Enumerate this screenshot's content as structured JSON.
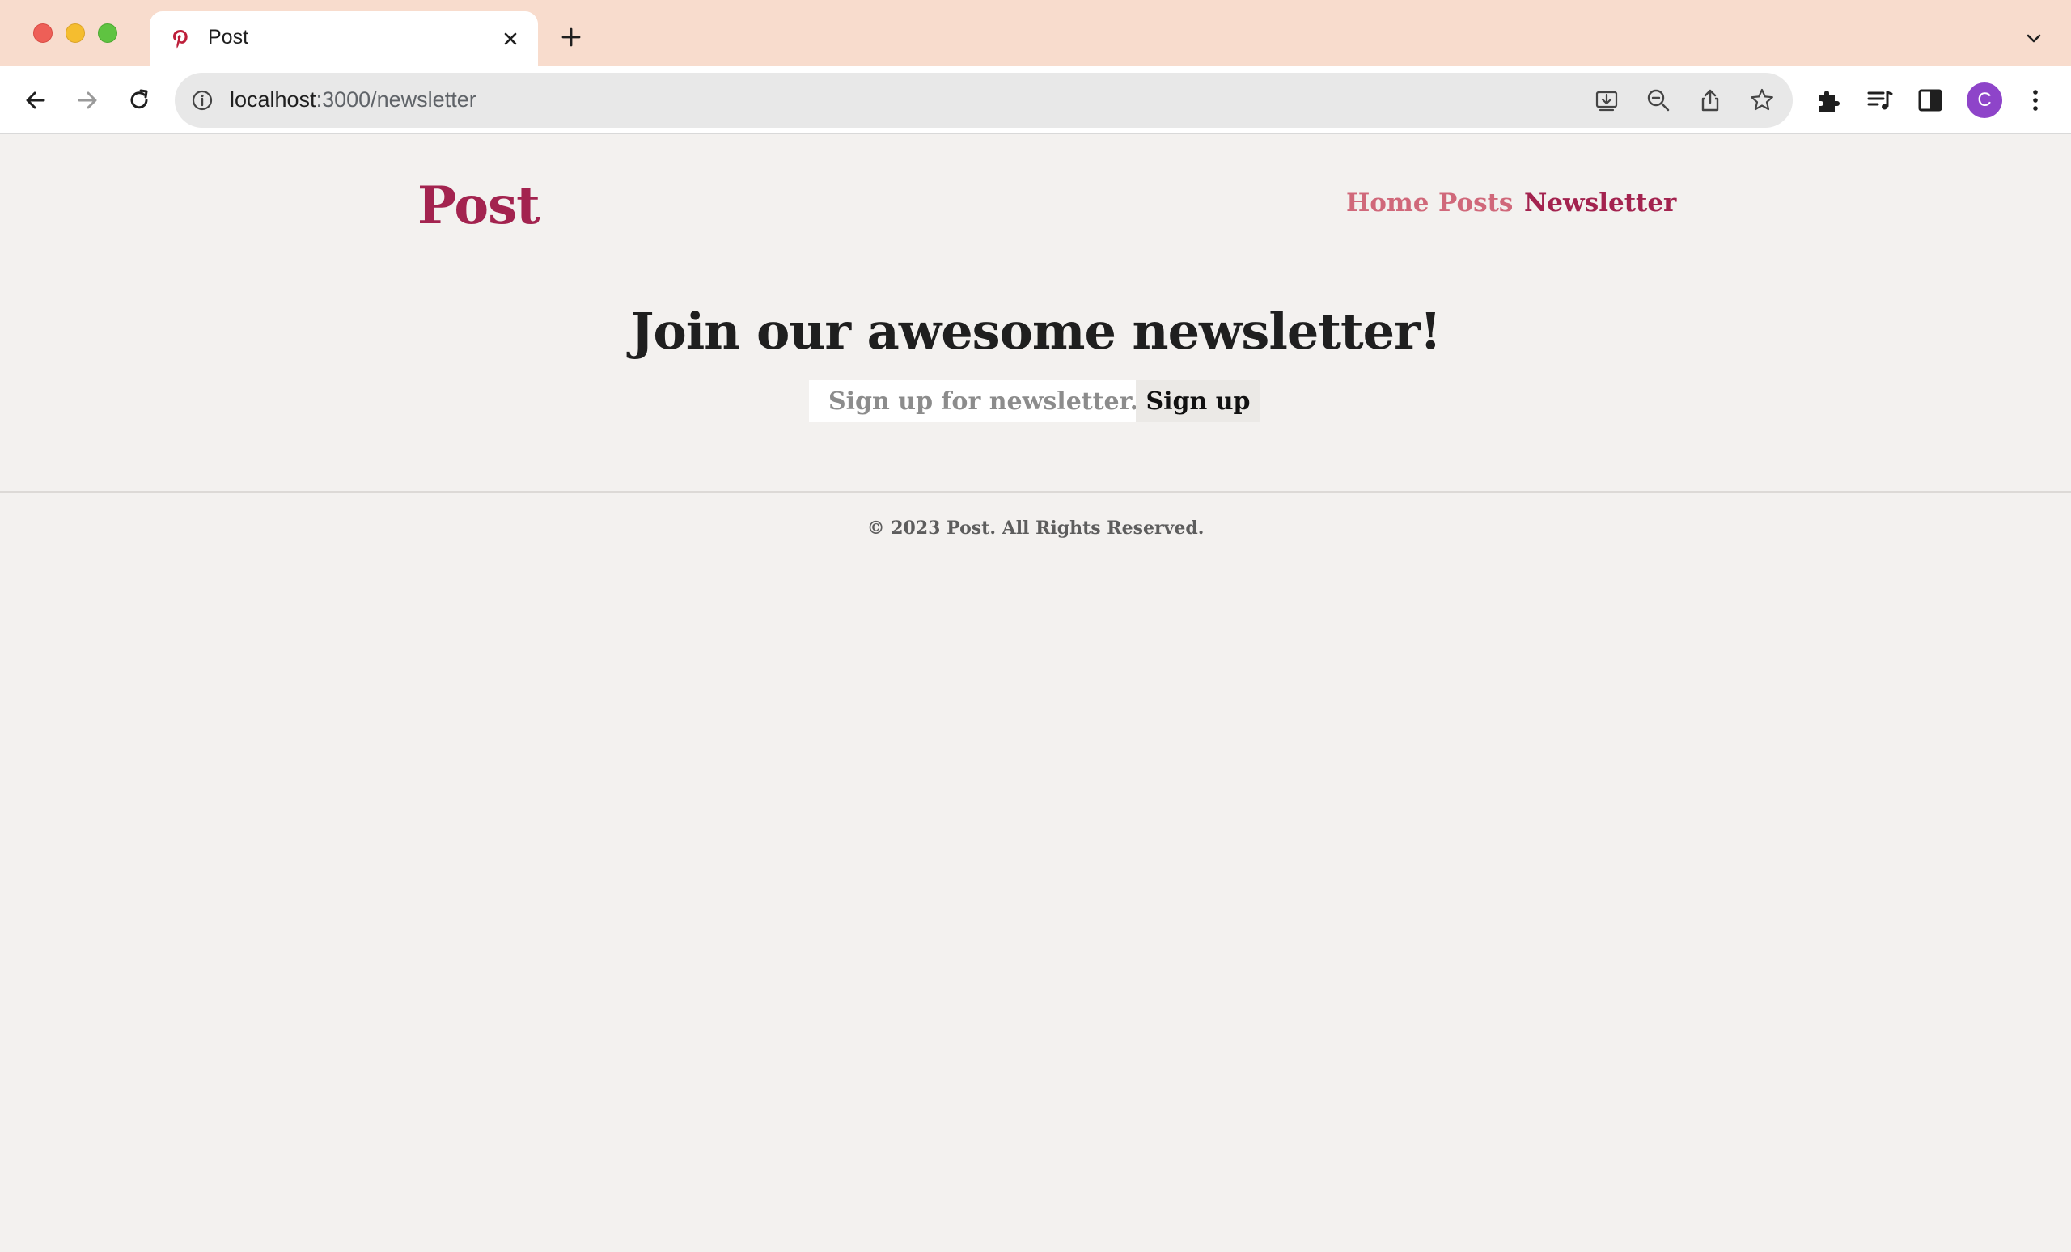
{
  "browser": {
    "tab": {
      "title": "Post",
      "favicon": "pinterest-icon"
    },
    "url": {
      "host": "localhost",
      "rest": ":3000/newsletter"
    },
    "profile_initial": "C",
    "colors": {
      "tabbar": "#f8dccd",
      "avatar": "#8e44c9"
    }
  },
  "site": {
    "logo": "Post",
    "nav": {
      "home": "Home",
      "posts": "Posts",
      "newsletter": "Newsletter"
    },
    "colors": {
      "brand": "#a3234f",
      "nav_inactive": "#d0687a",
      "background": "#f3f1ef"
    }
  },
  "main": {
    "headline": "Join our awesome newsletter!",
    "input_placeholder": "Sign up for newsletter...",
    "button_label": "Sign up"
  },
  "footer": {
    "text": "© 2023 Post. All Rights Reserved."
  }
}
